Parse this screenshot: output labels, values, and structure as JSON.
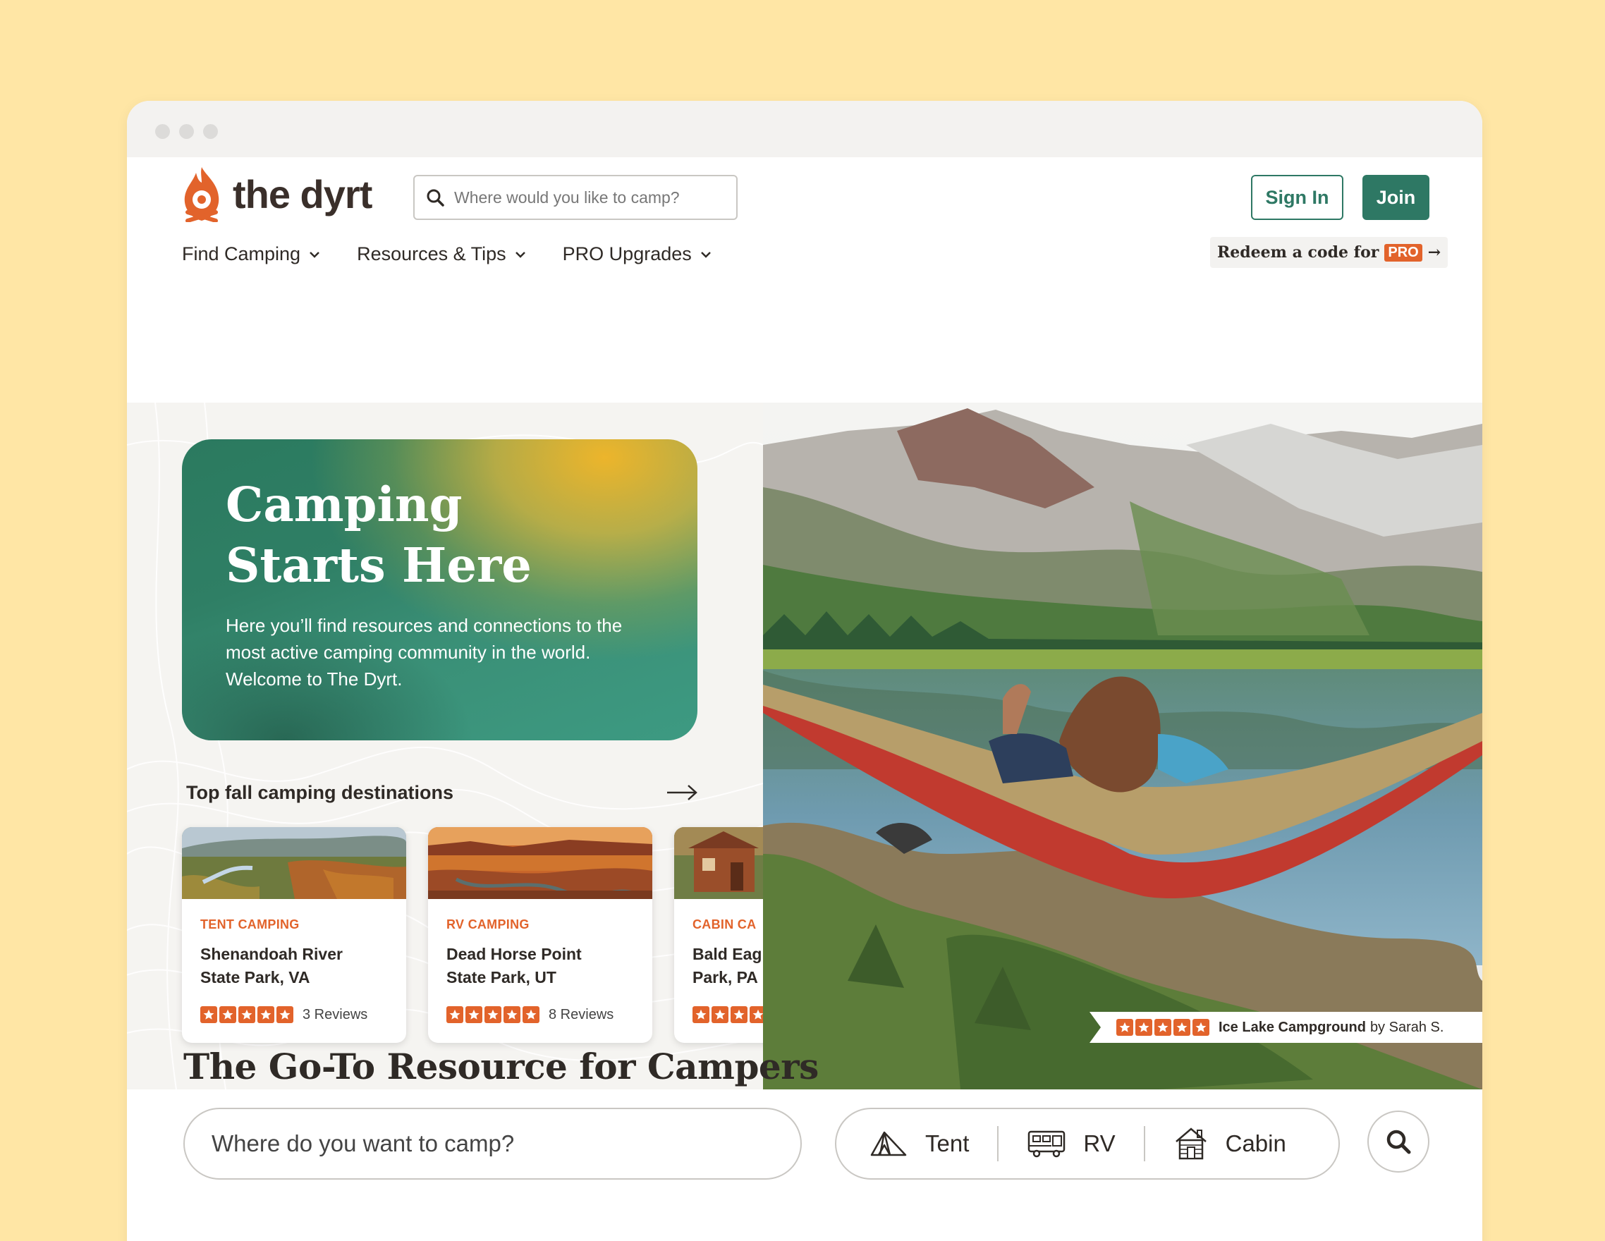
{
  "brand": {
    "name": "the dyrt",
    "accent": "#e2632b",
    "primary": "#2e7864",
    "background": "#ffe6a5"
  },
  "header": {
    "search_placeholder": "Where would you like to camp?",
    "sign_in": "Sign In",
    "join": "Join",
    "nav": [
      "Find Camping",
      "Resources & Tips",
      "PRO Upgrades"
    ],
    "redeem": {
      "prefix": "Redeem a code for",
      "badge": "PRO",
      "arrow": "→"
    }
  },
  "hero": {
    "title_line1": "Camping",
    "title_line2": "Starts Here",
    "body": "Here you’ll find resources and connections to the most active camping community in the world. Welcome to The Dyrt.",
    "destinations_title": "Top fall camping destinations",
    "cards": [
      {
        "category": "TENT CAMPING",
        "name_line1": "Shenandoah River",
        "name_line2": "State Park, VA",
        "rating": 5,
        "reviews": "3 Reviews"
      },
      {
        "category": "RV CAMPING",
        "name_line1": "Dead Horse Point",
        "name_line2": "State Park, UT",
        "rating": 5,
        "reviews": "8 Reviews"
      },
      {
        "category": "CABIN CA",
        "name_line1": "Bald Eag",
        "name_line2": "Park, PA",
        "rating": 5,
        "reviews": ""
      }
    ],
    "photo_credit": {
      "rating": 5,
      "campground": "Ice Lake Campground",
      "by": "by Sarah S."
    }
  },
  "resource": {
    "title": "The Go-To Resource for Campers",
    "search_placeholder": "Where do you want to camp?",
    "types": [
      {
        "label": "Tent",
        "icon": "tent-icon"
      },
      {
        "label": "RV",
        "icon": "rv-icon"
      },
      {
        "label": "Cabin",
        "icon": "cabin-icon"
      }
    ]
  }
}
